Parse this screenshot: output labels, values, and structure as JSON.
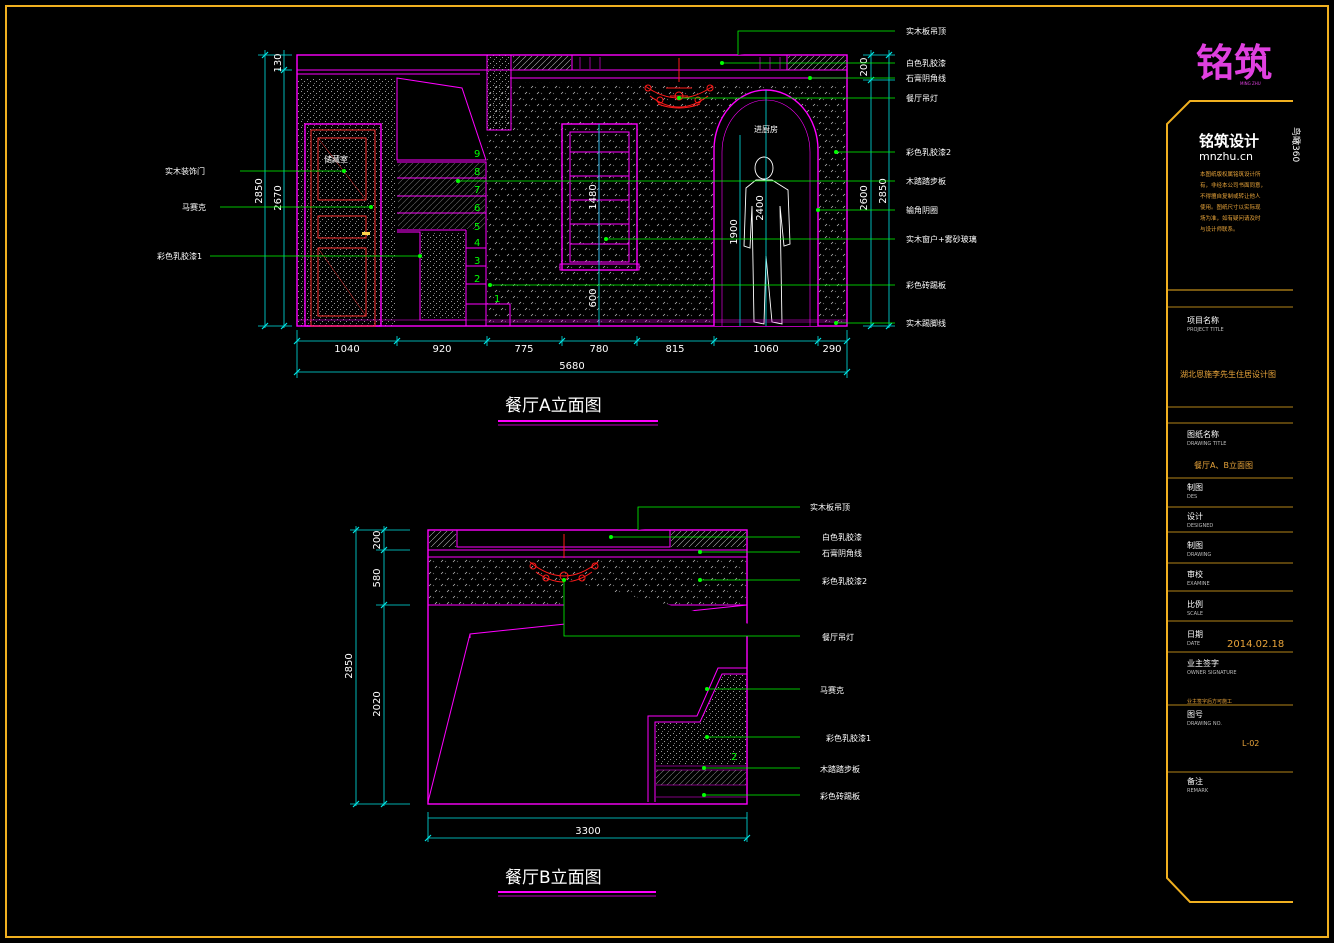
{
  "colors": {
    "background": "#000000",
    "frame": "#f0b020",
    "line_primary": "#ff00ff",
    "dimension": "#00e5e5",
    "leader": "#00ff00",
    "chandelier": "#ff1a1a",
    "text": "#ffffff"
  },
  "elevation_a": {
    "title": "餐厅A立面图",
    "dims_bottom": [
      "1040",
      "920",
      "775",
      "780",
      "815",
      "1060",
      "290"
    ],
    "dim_total": "5680",
    "dims_left": [
      "130",
      "2850",
      "2670"
    ],
    "dims_right": [
      "200",
      "2600",
      "2850"
    ],
    "dims_inner": [
      "1480",
      "600",
      "2400",
      "1900"
    ],
    "room_labels": {
      "storage": "储藏室",
      "entry": "进厨房"
    },
    "stair_numbers": [
      "9",
      "8",
      "7",
      "6",
      "5",
      "4",
      "3",
      "2",
      "1"
    ],
    "callouts_left": [
      "实木装饰门",
      "马赛克",
      "彩色乳胶漆1"
    ],
    "callouts_right": [
      "实木板吊顶",
      "白色乳胶漆",
      "石膏阴角线",
      "餐厅吊灯",
      "彩色乳胶漆2",
      "木踏踏步板",
      "输角阴圈",
      "实木窗户+雾砂玻璃",
      "彩色砖踢板",
      "实木踢脚线"
    ]
  },
  "elevation_b": {
    "title": "餐厅B立面图",
    "dims_left": [
      "200",
      "580",
      "2850",
      "2020"
    ],
    "dim_total": "3300",
    "stair_number": "2",
    "callouts_right": [
      "实木板吊顶",
      "白色乳胶漆",
      "石膏阴角线",
      "彩色乳胶漆2",
      "餐厅吊灯",
      "马赛克",
      "彩色乳胶漆1",
      "木踏踏步板",
      "彩色砖踢板"
    ]
  },
  "title_block": {
    "logo_text": "铭筑",
    "logo_sub": "MING ZHU",
    "brand_title": "铭筑设计",
    "brand_url": "mnzhu.cn",
    "brand_side": "鸟瞰360",
    "notes": [
      "本图纸版权属铭筑设计所",
      "有，非经本公司书面同意，",
      "不得擅自复制或转让他人",
      "使用。图纸尺寸以实际现",
      "场为准，如有疑问请及时",
      "与设计师联系。"
    ],
    "fields": [
      {
        "label": "项目名称",
        "sub": "PROJECT TITLE",
        "value": "湖北恩施李先生住居设计图"
      },
      {
        "label": "图纸名称",
        "sub": "DRAWING TITLE",
        "value": "餐厅A、B立面图"
      },
      {
        "label": "制图",
        "sub": "DES",
        "value": ""
      },
      {
        "label": "设计",
        "sub": "DESIGNED",
        "value": ""
      },
      {
        "label": "制图",
        "sub": "DRAWING",
        "value": ""
      },
      {
        "label": "审校",
        "sub": "EXAMINE",
        "value": ""
      },
      {
        "label": "比例",
        "sub": "SCALE",
        "value": ""
      },
      {
        "label": "日期",
        "sub": "DATE",
        "value": "2014.02.18"
      },
      {
        "label": "业主签字",
        "sub": "OWNER SIGNATURE",
        "value": "业主签字后方可施工"
      },
      {
        "label": "图号",
        "sub": "DRAWING NO.",
        "value": "L-02"
      },
      {
        "label": "备注",
        "sub": "REMARK",
        "value": ""
      }
    ]
  }
}
